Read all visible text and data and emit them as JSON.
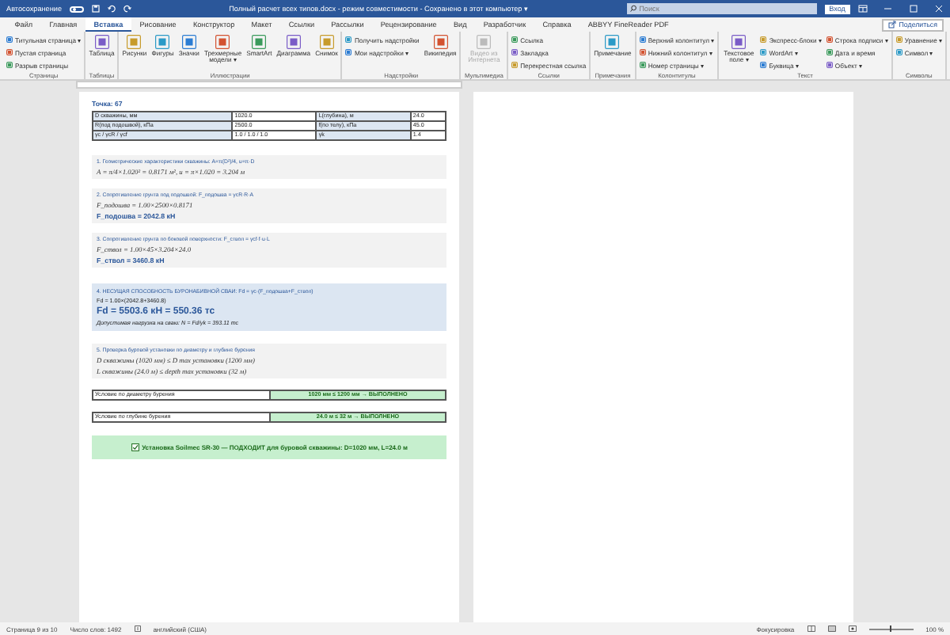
{
  "title_bar": {
    "autosave_label": "Автосохранение",
    "autosave_on": false,
    "document_title": "Полный расчет всех типов.docx  -  режим совместимости  -  Сохранено в этот компьютер ▾",
    "search_placeholder": "Поиск",
    "sign_in": "Вход"
  },
  "tabs": [
    {
      "label": "Файл",
      "selected": false
    },
    {
      "label": "Главная",
      "selected": false
    },
    {
      "label": "Вставка",
      "selected": true
    },
    {
      "label": "Рисование",
      "selected": false
    },
    {
      "label": "Конструктор",
      "selected": false
    },
    {
      "label": "Макет",
      "selected": false
    },
    {
      "label": "Ссылки",
      "selected": false
    },
    {
      "label": "Рассылки",
      "selected": false
    },
    {
      "label": "Рецензирование",
      "selected": false
    },
    {
      "label": "Вид",
      "selected": false
    },
    {
      "label": "Разработчик",
      "selected": false
    },
    {
      "label": "Справка",
      "selected": false
    },
    {
      "label": "ABBYY FineReader PDF",
      "selected": false
    }
  ],
  "share_button": "Поделиться",
  "ribbon": [
    {
      "label": "Страницы",
      "items": [
        {
          "kind": "small",
          "label": "Титульная страница ▾",
          "disabled": false
        },
        {
          "kind": "small",
          "label": "Пустая страница",
          "disabled": false
        },
        {
          "kind": "small",
          "label": "Разрыв страницы",
          "disabled": false
        }
      ]
    },
    {
      "label": "Таблицы",
      "items": [
        {
          "kind": "large",
          "label": "Таблица",
          "disabled": false
        }
      ]
    },
    {
      "label": "Иллюстрации",
      "items": [
        {
          "kind": "large",
          "label": "Рисунки",
          "disabled": false
        },
        {
          "kind": "large",
          "label": "Фигуры",
          "disabled": false
        },
        {
          "kind": "large",
          "label": "Значки",
          "disabled": false
        },
        {
          "kind": "large",
          "label": "Трехмерные модели ▾",
          "disabled": false
        },
        {
          "kind": "large",
          "label": "SmartArt",
          "disabled": false
        },
        {
          "kind": "large",
          "label": "Диаграмма",
          "disabled": false
        },
        {
          "kind": "large",
          "label": "Снимок",
          "disabled": false
        }
      ]
    },
    {
      "label": "Надстройки",
      "items": [
        {
          "kind": "small",
          "label": "Получить надстройки",
          "disabled": false
        },
        {
          "kind": "small",
          "label": "Мои надстройки ▾",
          "disabled": false
        },
        {
          "kind": "large",
          "label": "Википедия",
          "disabled": false
        }
      ]
    },
    {
      "label": "Мультимедиа",
      "items": [
        {
          "kind": "large",
          "label": "Видео из Интернета",
          "disabled": true
        }
      ]
    },
    {
      "label": "Ссылки",
      "items": [
        {
          "kind": "small",
          "label": "Ссылка",
          "disabled": false
        },
        {
          "kind": "small",
          "label": "Закладка",
          "disabled": false
        },
        {
          "kind": "small",
          "label": "Перекрестная ссылка",
          "disabled": false
        }
      ]
    },
    {
      "label": "Примечания",
      "items": [
        {
          "kind": "large",
          "label": "Примечание",
          "disabled": false
        }
      ]
    },
    {
      "label": "Колонтитулы",
      "items": [
        {
          "kind": "small",
          "label": "Верхний колонтитул ▾",
          "disabled": false
        },
        {
          "kind": "small",
          "label": "Нижний колонтитул ▾",
          "disabled": false
        },
        {
          "kind": "small",
          "label": "Номер страницы ▾",
          "disabled": false
        }
      ]
    },
    {
      "label": "Текст",
      "items": [
        {
          "kind": "large",
          "label": "Текстовое поле ▾",
          "disabled": false
        },
        {
          "kind": "small",
          "label": "Экспресс-блоки ▾",
          "disabled": false
        },
        {
          "kind": "small",
          "label": "WordArt ▾",
          "disabled": false
        },
        {
          "kind": "small",
          "label": "Буквица ▾",
          "disabled": false
        },
        {
          "kind": "small",
          "label": "Строка подписи ▾",
          "disabled": false
        },
        {
          "kind": "small",
          "label": "Дата и время",
          "disabled": false
        },
        {
          "kind": "small",
          "label": "Объект ▾",
          "disabled": false
        }
      ]
    },
    {
      "label": "Символы",
      "items": [
        {
          "kind": "small",
          "label": "Уравнение ▾",
          "disabled": false
        },
        {
          "kind": "small",
          "label": "Символ ▾",
          "disabled": false
        }
      ]
    }
  ],
  "document": {
    "point_title": "Точка: 67",
    "params": [
      [
        "D скважины, мм",
        "1020.0",
        "L(глубина), м",
        "24.0"
      ],
      [
        "R(под подошвой), кПа",
        "2500.0",
        "f(по телу), кПа",
        "45.0"
      ],
      [
        "γc / γcR / γcf",
        "1.0 / 1.0 / 1.0",
        "γk",
        "1.4"
      ]
    ],
    "sections": [
      {
        "kind": "plain",
        "heading": "1. Геометрические характеристики скважины: A=π(D²)/4, u=π·D",
        "lines": [
          {
            "kind": "formula",
            "text": "A = π/4×1.020² = 0.8171 м², u = π×1.020 = 3.204 м"
          }
        ]
      },
      {
        "kind": "plain",
        "heading": "2. Сопротивление грунта под подошвой: F_подошва = γcR·R·A",
        "lines": [
          {
            "kind": "formula",
            "text": "F_подошва = 1.00×2500×0.8171"
          },
          {
            "kind": "result",
            "text": "F_подошва = 2042.8 кН"
          }
        ]
      },
      {
        "kind": "plain",
        "heading": "3. Сопротивление грунта по боковой поверхности: F_ствол = γcf·f·u·L",
        "lines": [
          {
            "kind": "formula",
            "text": "F_ствол = 1.00×45×3.204×24.0"
          },
          {
            "kind": "result",
            "text": "F_ствол = 3460.8 кН"
          }
        ]
      },
      {
        "kind": "highlight",
        "heading": "4. НЕСУЩАЯ СПОСОБНОСТЬ БУРОНАБИВНОЙ СВАИ: Fd = γc·(F_подошва+F_ствол)",
        "lines": [
          {
            "kind": "note",
            "text": "Fd = 1.00×(2042.8+3460.8)"
          },
          {
            "kind": "big",
            "text": "Fd = 5503.6 кН = 550.36 тс"
          },
          {
            "kind": "note_italic",
            "text": "Допустимая нагрузка на сваю: N = Fd/γk = 393.11 тс"
          }
        ]
      },
      {
        "kind": "plain",
        "heading": "5. Проверка буровой установки по диаметру и глубине бурения",
        "lines": [
          {
            "kind": "formula",
            "text": "D скважины (1020 мм) ≤ D max установки (1200 мм)"
          },
          {
            "kind": "formula",
            "text": "L скважины (24.0 м) ≤ depth max установки (32 м)"
          }
        ]
      }
    ],
    "checks": [
      {
        "label": "Условие по диаметру бурения",
        "value": "1020 мм ≤ 1200 мм → ВЫПОЛНЕНО"
      },
      {
        "label": "Условие по глубине бурения",
        "value": "24.0 м ≤ 32 м → ВЫПОЛНЕНО"
      }
    ],
    "verdict": "Установка Soilmec SR-30 — ПОДХОДИТ для буровой скважины: D=1020 мм, L=24.0 м"
  },
  "status_bar": {
    "page": "Страница 9 из 10",
    "words": "Число слов: 1492",
    "language": "английский (США)",
    "focus": "Фокусировка",
    "zoom": "100 %",
    "zoom_slider": {
      "level": 0.5
    }
  }
}
